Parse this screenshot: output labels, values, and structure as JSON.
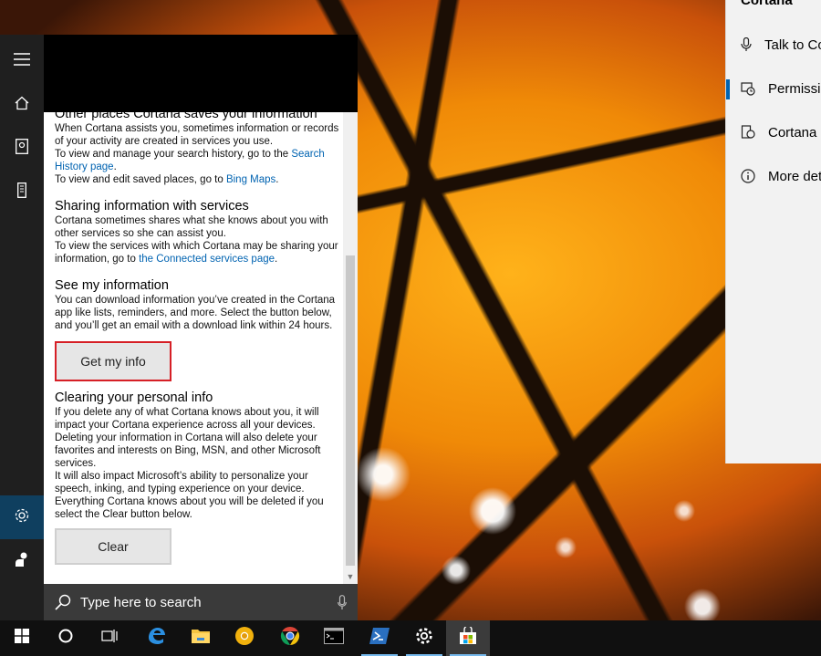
{
  "settings_window": {
    "title": "Cortana",
    "items": [
      {
        "label": "Talk to Cortana",
        "icon": "microphone-icon",
        "active": false
      },
      {
        "label": "Permissions & History",
        "icon": "shield-history-icon",
        "active": true
      },
      {
        "label": "Cortana across my devices",
        "icon": "device-cortana-icon",
        "active": false
      },
      {
        "label": "More details",
        "icon": "info-icon",
        "active": false
      }
    ]
  },
  "rail": {
    "items": [
      {
        "name": "hamburger-menu",
        "icon": "hamburger-icon"
      },
      {
        "name": "home",
        "icon": "home-icon"
      },
      {
        "name": "notebook",
        "icon": "notebook-icon"
      },
      {
        "name": "devices",
        "icon": "device-icon"
      },
      {
        "name": "settings",
        "icon": "gear-icon",
        "selected": true
      },
      {
        "name": "feedback",
        "icon": "feedback-icon"
      }
    ]
  },
  "content": {
    "sections": [
      {
        "title": "Other places Cortana saves your information",
        "p1": "When Cortana assists you, sometimes information or records of your activity are created in services you use.",
        "p2_prefix": "To view and manage your search history, go to the ",
        "p2_link": "Search History page",
        "p2_suffix": ".",
        "p3_prefix": "To view and edit saved places, go to ",
        "p3_link": "Bing Maps",
        "p3_suffix": "."
      },
      {
        "title": "Sharing information with services",
        "p1": "Cortana sometimes shares what she knows about you with other services so she can assist you.",
        "p2_prefix": "To view the services with which Cortana may be sharing your information, go to ",
        "p2_link": "the Connected services page",
        "p2_suffix": "."
      },
      {
        "title": "See my information",
        "p1": "You can download information you’ve created in the Cortana app like lists, reminders, and more. Select the button below, and you’ll get an email with a download link within 24 hours.",
        "button": "Get my info"
      },
      {
        "title": "Clearing your personal info",
        "p1": "If you delete any of what Cortana knows about you, it will impact your Cortana experience across all your devices. Deleting your information in Cortana will also delete your favorites and interests on Bing, MSN, and other Microsoft services.",
        "p2": "It will also impact Microsoft’s ability to personalize your speech, inking, and typing experience on your device. Everything Cortana knows about you will be deleted if you select the Clear button below.",
        "button": "Clear"
      }
    ]
  },
  "search": {
    "placeholder": "Type here to search"
  },
  "taskbar": {
    "items": [
      {
        "name": "start",
        "icon": "windows-logo-icon"
      },
      {
        "name": "cortana",
        "icon": "cortana-circle-icon"
      },
      {
        "name": "task-view",
        "icon": "task-view-icon"
      },
      {
        "name": "edge",
        "icon": "edge-icon"
      },
      {
        "name": "file-explorer",
        "icon": "folder-icon"
      },
      {
        "name": "chrome-canary",
        "icon": "canary-icon"
      },
      {
        "name": "chrome",
        "icon": "chrome-icon"
      },
      {
        "name": "command-prompt",
        "icon": "cmd-icon"
      },
      {
        "name": "powershell",
        "icon": "powershell-icon"
      },
      {
        "name": "settings",
        "icon": "gear-icon"
      },
      {
        "name": "store",
        "icon": "store-icon"
      }
    ]
  },
  "colors": {
    "accent": "#0063b1",
    "highlight_box": "#d61f26",
    "rail_bg": "#1f1f1f",
    "taskbar_bg": "#101010"
  }
}
